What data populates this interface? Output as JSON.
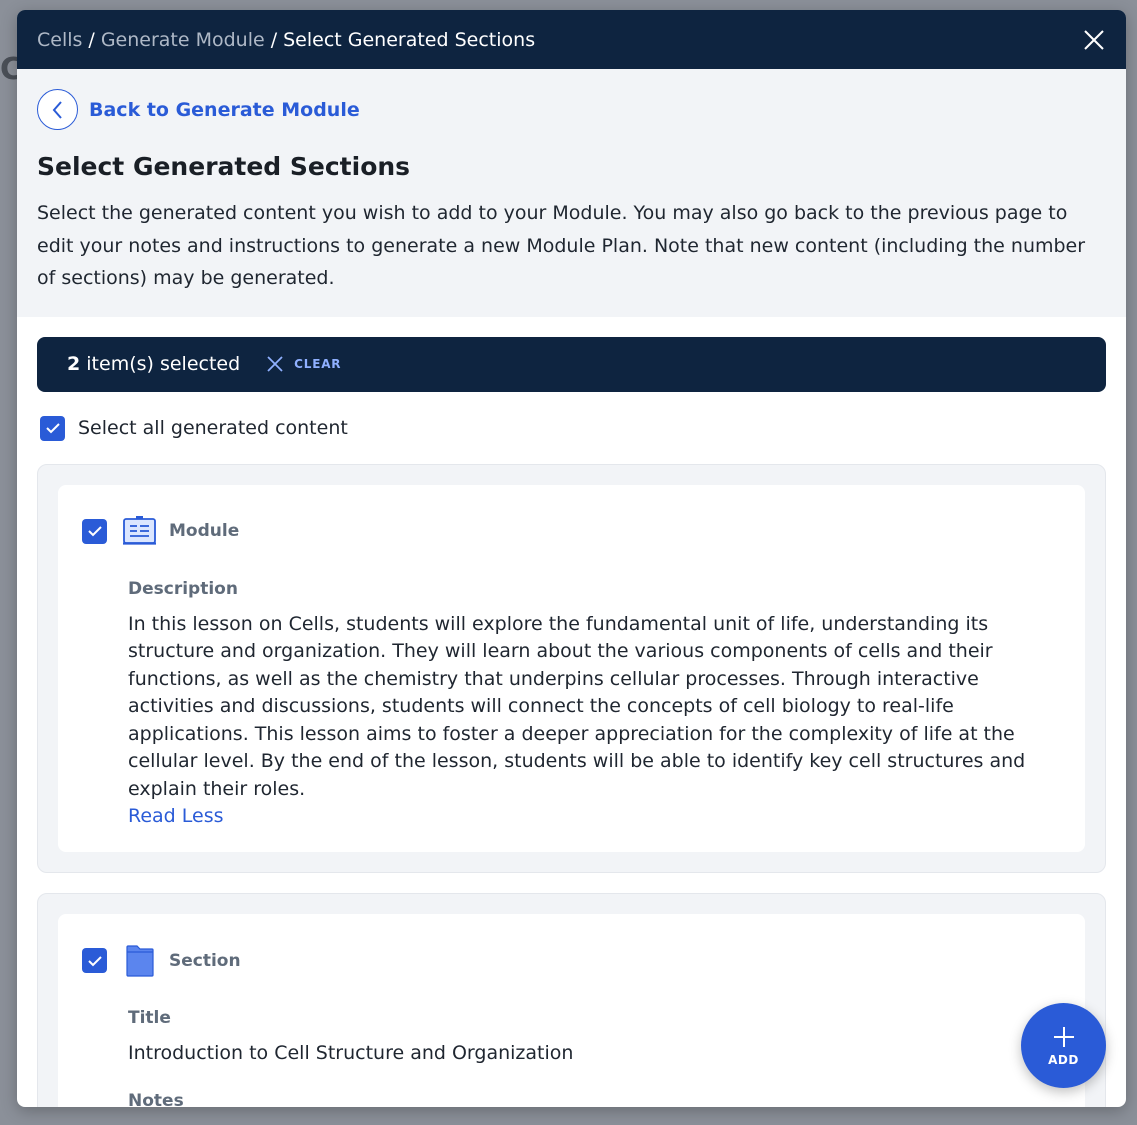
{
  "backdrop": {
    "letter": "C"
  },
  "header": {
    "breadcrumb": [
      {
        "label": "Cells"
      },
      {
        "label": "Generate Module"
      }
    ],
    "separator": "/",
    "current": "Select Generated Sections"
  },
  "intro": {
    "back_label": "Back to Generate Module",
    "title": "Select Generated Sections",
    "description": "Select the generated content you wish to add to your Module. You may also go back to the previous page to edit your notes and instructions to generate a new Module Plan. Note that new content (including the number of sections) may be generated."
  },
  "selection": {
    "count": "2",
    "suffix": " item(s) selected",
    "clear_label": "CLEAR",
    "select_all_label": "Select all generated content"
  },
  "cards": [
    {
      "type": "Module",
      "icon": "module-board-icon",
      "checked": true,
      "field_label": "Description",
      "text": "In this lesson on Cells, students will explore the fundamental unit of life, understanding its structure and organization. They will learn about the various components of cells and their functions, as well as the chemistry that underpins cellular processes. Through interactive activities and discussions, students will connect the concepts of cell biology to real-life applications. This lesson aims to foster a deeper appreciation for the complexity of life at the cellular level. By the end of the lesson, students will be able to identify key cell structures and explain their roles.",
      "read_less": "Read Less"
    },
    {
      "type": "Section",
      "icon": "folder-icon",
      "checked": true,
      "field_label": "Title",
      "text": "Introduction to Cell Structure and Organization",
      "next_field_label": "Notes"
    }
  ],
  "fab": {
    "label": "ADD",
    "icon": "plus-icon"
  },
  "colors": {
    "header_bg": "#0e2440",
    "accent": "#2a5bd7",
    "intro_bg": "#f2f4f7"
  }
}
